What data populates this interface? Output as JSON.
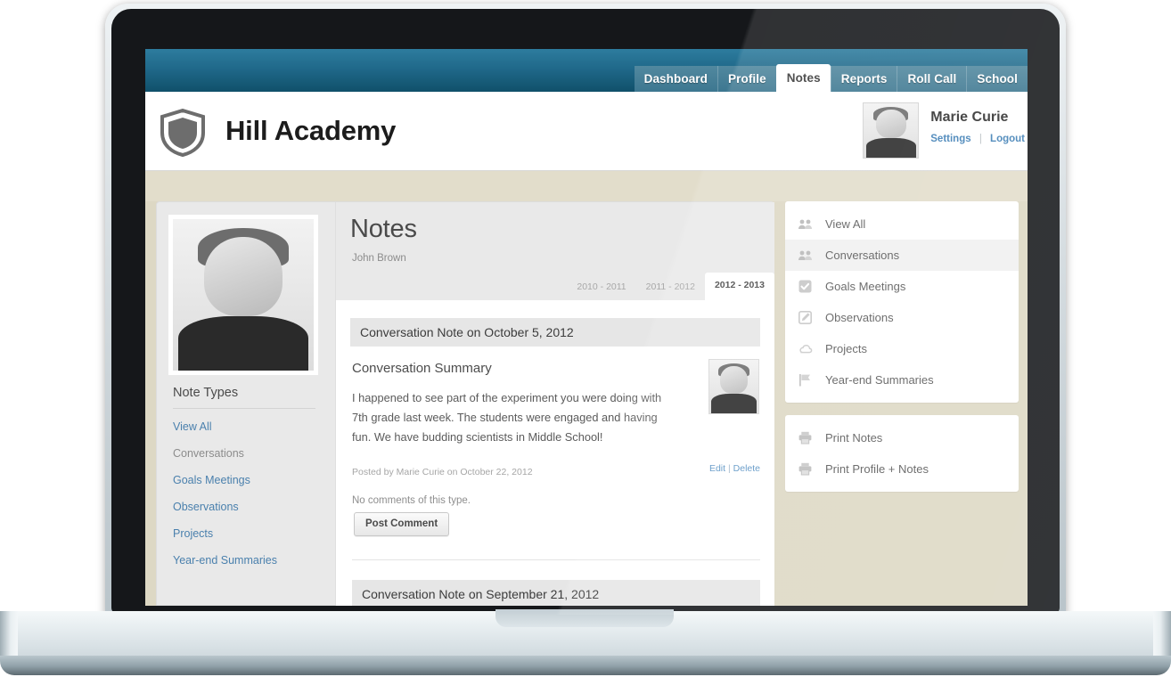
{
  "app": {
    "brand_title": "Hill Academy",
    "logo_icon": "shield-icon"
  },
  "nav": {
    "tabs": [
      {
        "label": "Dashboard",
        "active": false
      },
      {
        "label": "Profile",
        "active": false
      },
      {
        "label": "Notes",
        "active": true
      },
      {
        "label": "Reports",
        "active": false
      },
      {
        "label": "Roll Call",
        "active": false
      },
      {
        "label": "School",
        "active": false
      }
    ]
  },
  "user": {
    "name": "Marie Curie",
    "settings_label": "Settings",
    "separator": "|",
    "logout_label": "Logout",
    "avatar_icon": "avatar"
  },
  "left_sidebar": {
    "heading": "Note Types",
    "items": [
      {
        "label": "View All",
        "current": false
      },
      {
        "label": "Conversations",
        "current": true
      },
      {
        "label": "Goals Meetings",
        "current": false
      },
      {
        "label": "Observations",
        "current": false
      },
      {
        "label": "Projects",
        "current": false
      },
      {
        "label": "Year-end Summaries",
        "current": false
      }
    ]
  },
  "main": {
    "title": "Notes",
    "subtitle": "John Brown",
    "year_tabs": [
      {
        "label": "2010 - 2011",
        "active": false
      },
      {
        "label": "2011 - 2012",
        "active": false
      },
      {
        "label": "2012 - 2013",
        "active": true
      }
    ],
    "notes": [
      {
        "header": "Conversation Note on October 5, 2012",
        "subheading": "Conversation Summary",
        "text": "I happened to see part of the experiment you were doing with 7th grade last week. The students were engaged and having fun. We have budding scientists in Middle School!",
        "posted": "Posted by Marie Curie on October 22, 2012",
        "edit_label": "Edit",
        "meta_separator": "|",
        "delete_label": "Delete",
        "no_comments": "No comments of this type.",
        "post_comment_label": "Post Comment"
      },
      {
        "header": "Conversation Note on September 21, 2012"
      }
    ]
  },
  "right_rail": {
    "filters": [
      {
        "label": "View All",
        "icon": "people-group-icon",
        "active": false
      },
      {
        "label": "Conversations",
        "icon": "people-group-icon",
        "active": true
      },
      {
        "label": "Goals Meetings",
        "icon": "checkbox-checked-icon",
        "active": false
      },
      {
        "label": "Observations",
        "icon": "pencil-edit-icon",
        "active": false
      },
      {
        "label": "Projects",
        "icon": "cloud-icon",
        "active": false
      },
      {
        "label": "Year-end Summaries",
        "icon": "flag-icon",
        "active": false
      }
    ],
    "print_actions": [
      {
        "label": "Print Notes",
        "icon": "printer-icon"
      },
      {
        "label": "Print Profile + Notes",
        "icon": "printer-icon"
      }
    ]
  },
  "colors": {
    "header_blue": "#20698a",
    "accent_link": "#4a80ad",
    "page_beige": "#ddd8c4",
    "panel_gray": "#e9e9e9"
  }
}
